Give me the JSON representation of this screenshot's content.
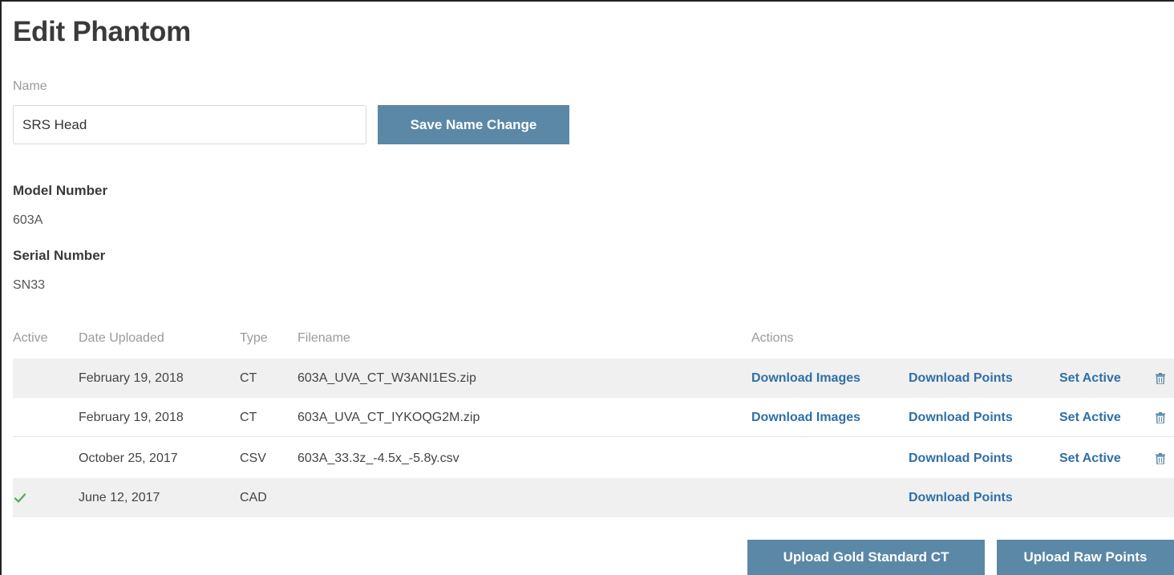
{
  "page": {
    "title": "Edit Phantom"
  },
  "name_section": {
    "label": "Name",
    "value": "SRS Head",
    "save_label": "Save Name Change"
  },
  "details": {
    "model_label": "Model Number",
    "model_value": "603A",
    "serial_label": "Serial Number",
    "serial_value": "SN33"
  },
  "table": {
    "headers": {
      "active": "Active",
      "date": "Date Uploaded",
      "type": "Type",
      "filename": "Filename",
      "actions": "Actions"
    },
    "rows": [
      {
        "active": false,
        "date": "February 19, 2018",
        "type": "CT",
        "filename": "603A_UVA_CT_W3ANI1ES.zip",
        "download_images": "Download Images",
        "download_points": "Download Points",
        "set_active": "Set Active",
        "delete_icon": "trash-icon"
      },
      {
        "active": false,
        "date": "February 19, 2018",
        "type": "CT",
        "filename": "603A_UVA_CT_IYKOQG2M.zip",
        "download_images": "Download Images",
        "download_points": "Download Points",
        "set_active": "Set Active",
        "delete_icon": "trash-icon"
      },
      {
        "active": false,
        "date": "October 25, 2017",
        "type": "CSV",
        "filename": "603A_33.3z_-4.5x_-5.8y.csv",
        "download_points": "Download Points",
        "set_active": "Set Active",
        "delete_icon": "trash-icon"
      },
      {
        "active": true,
        "date": "June 12, 2017",
        "type": "CAD",
        "filename": "",
        "download_points": "Download Points",
        "active_icon": "checkmark-icon"
      }
    ]
  },
  "footer_buttons": {
    "upload_ct": "Upload Gold Standard CT",
    "upload_points": "Upload Raw Points"
  },
  "colors": {
    "accent_button": "#5b88a6",
    "link": "#2e6fa7",
    "active_check": "#4caf50",
    "row_shade": "#f0f0f0"
  }
}
